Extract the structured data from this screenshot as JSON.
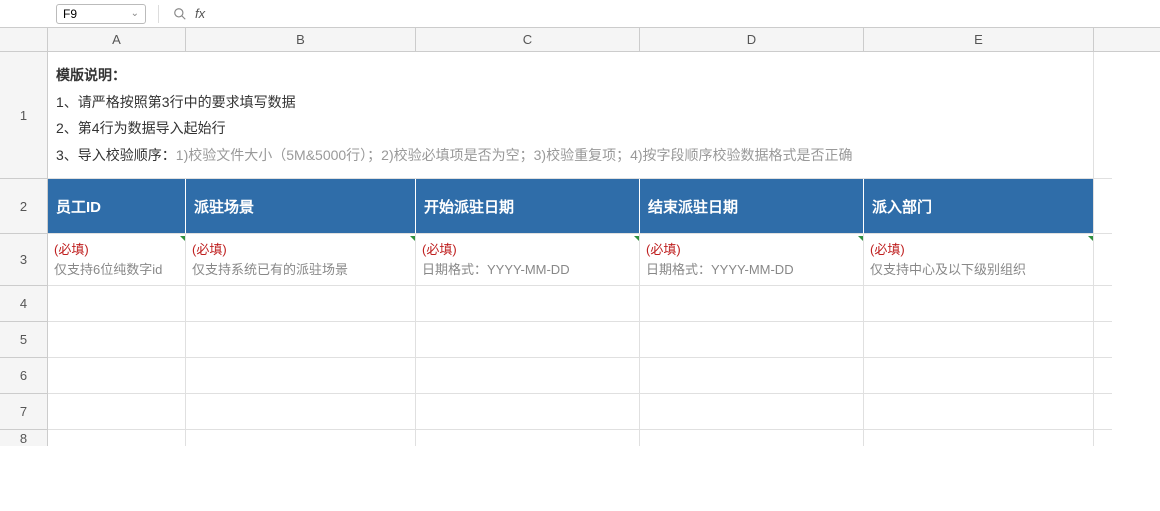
{
  "formula_bar": {
    "cell_ref": "F9",
    "fx_label": "fx",
    "formula_value": ""
  },
  "columns": {
    "A": "A",
    "B": "B",
    "C": "C",
    "D": "D",
    "E": "E"
  },
  "row_numbers": [
    "1",
    "2",
    "3",
    "4",
    "5",
    "6",
    "7",
    "8"
  ],
  "instructions": {
    "title": "模版说明：",
    "line1": "1、请严格按照第3行中的要求填写数据",
    "line2": "2、第4行为数据导入起始行",
    "line3_prefix": "3、导入校验顺序：",
    "line3_gray": "1)校验文件大小（5M&5000行）；2)校验必填项是否为空；3)校验重复项；4)按字段顺序校验数据格式是否正确"
  },
  "headers": {
    "A": "员工ID",
    "B": "派驻场景",
    "C": "开始派驻日期",
    "D": "结束派驻日期",
    "E": "派入部门"
  },
  "hints": {
    "required": "(必填)",
    "A": "仅支持6位纯数字id",
    "B": "仅支持系统已有的派驻场景",
    "C": "日期格式：YYYY-MM-DD",
    "D": "日期格式：YYYY-MM-DD",
    "E": "仅支持中心及以下级别组织"
  }
}
